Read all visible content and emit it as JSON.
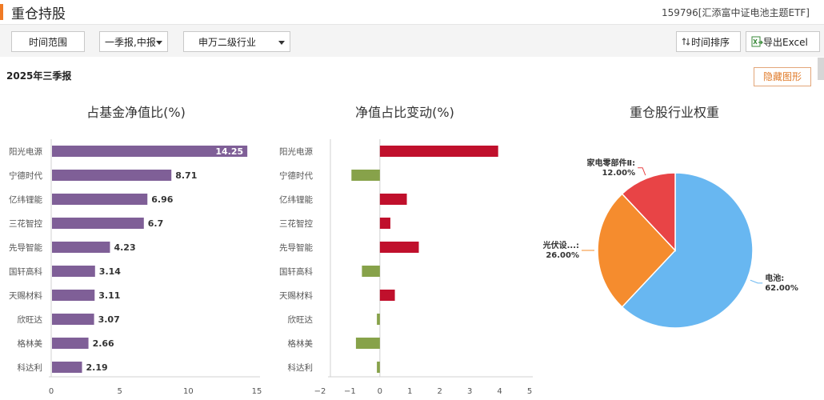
{
  "header": {
    "title": "重仓持股",
    "fund": "159796[汇添富中证电池主题ETF]"
  },
  "toolbar": {
    "time_range": "时间范围",
    "report": "一季报,中报",
    "industry": "申万二级行业",
    "sort": "时间排序",
    "sort_icon": "sort-icon",
    "export": "导出Excel",
    "export_icon": "excel-icon"
  },
  "period": "2025年三季报",
  "hide_chart": "隐藏图形",
  "accent": "#f07a24",
  "chart_data": [
    {
      "type": "bar",
      "orientation": "horizontal",
      "title": "占基金净值比(%)",
      "categories": [
        "阳光电源",
        "宁德时代",
        "亿纬锂能",
        "三花智控",
        "先导智能",
        "国轩高科",
        "天赐材料",
        "欣旺达",
        "格林美",
        "科达利"
      ],
      "values": [
        14.25,
        8.71,
        6.96,
        6.7,
        4.23,
        3.14,
        3.11,
        3.07,
        2.66,
        2.19
      ],
      "value_labels": [
        "14.25",
        "8.71",
        "6.96",
        "6.7",
        "4.23",
        "3.14",
        "3.11",
        "3.07",
        "2.66",
        "2.19"
      ],
      "xlim": [
        0,
        15
      ],
      "xticks": [
        "0",
        "5",
        "10",
        "15"
      ],
      "color": "#7f5f97"
    },
    {
      "type": "bar",
      "orientation": "horizontal",
      "title": "净值占比变动(%)",
      "categories": [
        "阳光电源",
        "宁德时代",
        "亿纬锂能",
        "三花智控",
        "先导智能",
        "国轩高科",
        "天赐材料",
        "欣旺达",
        "格林美",
        "科达利"
      ],
      "values": [
        3.95,
        -0.95,
        0.9,
        0.35,
        1.3,
        -0.6,
        0.5,
        -0.1,
        -0.8,
        -0.1
      ],
      "xlim": [
        -2,
        5
      ],
      "xticks": [
        "−2",
        "−1",
        "0",
        "1",
        "2",
        "3",
        "4",
        "5"
      ],
      "pos_color": "#c0102c",
      "neg_color": "#87a24a"
    },
    {
      "type": "pie",
      "title": "重仓股行业权重",
      "labels": [
        "电池",
        "光伏设...",
        "家电零部件Ⅱ"
      ],
      "values": [
        62.0,
        26.0,
        12.0
      ],
      "value_labels": [
        "62.00%",
        "26.00%",
        "12.00%"
      ],
      "colors": [
        "#68b7f1",
        "#f58c2e",
        "#e84446"
      ]
    }
  ]
}
